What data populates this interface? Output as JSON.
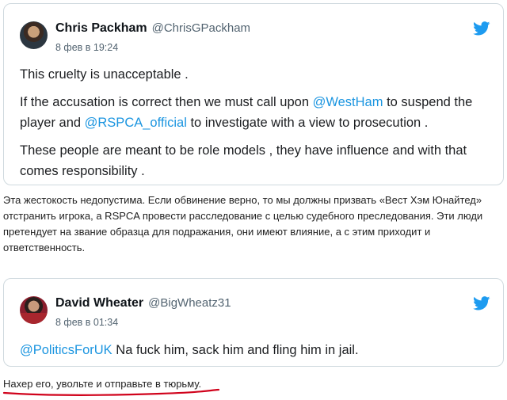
{
  "tweet1": {
    "author_name": "Chris Packham",
    "author_handle": "@ChrisGPackham",
    "date": "8 фев в 19:24",
    "paragraph1": "This cruelty is unacceptable .",
    "paragraph2_pre": "If the accusation is correct then we must call upon ",
    "mention1": "@WestHam",
    "paragraph2_mid": " to suspend the player and ",
    "mention2": "@RSPCA_official",
    "paragraph2_post": " to investigate with a view to prosecution .",
    "paragraph3": "These people are meant to be role models , they have influence and with that comes responsibility ."
  },
  "caption1": "Эта жестокость недопустима. Если обвинение верно, то мы должны призвать «Вест Хэм Юнайтед» отстранить игрока, а RSPCA провести расследование с целью судебного преследования. Эти люди претендует на звание образца для подражания, они имеют влияние, а с этим приходит и ответственность.",
  "tweet2": {
    "author_name": "David Wheater",
    "author_handle": "@BigWheatz31",
    "date": "8 фев в 01:34",
    "mention": "@PoliticsForUK",
    "text": " Na fuck him, sack him and fling him in jail."
  },
  "caption2": "Нахер его, увольте и отправьте в тюрьму.",
  "colors": {
    "twitter_blue": "#1d9bf0",
    "mention_blue": "#1b95e0",
    "underline_red": "#d0021b"
  },
  "icons": {
    "brand": "twitter-bird-icon"
  }
}
